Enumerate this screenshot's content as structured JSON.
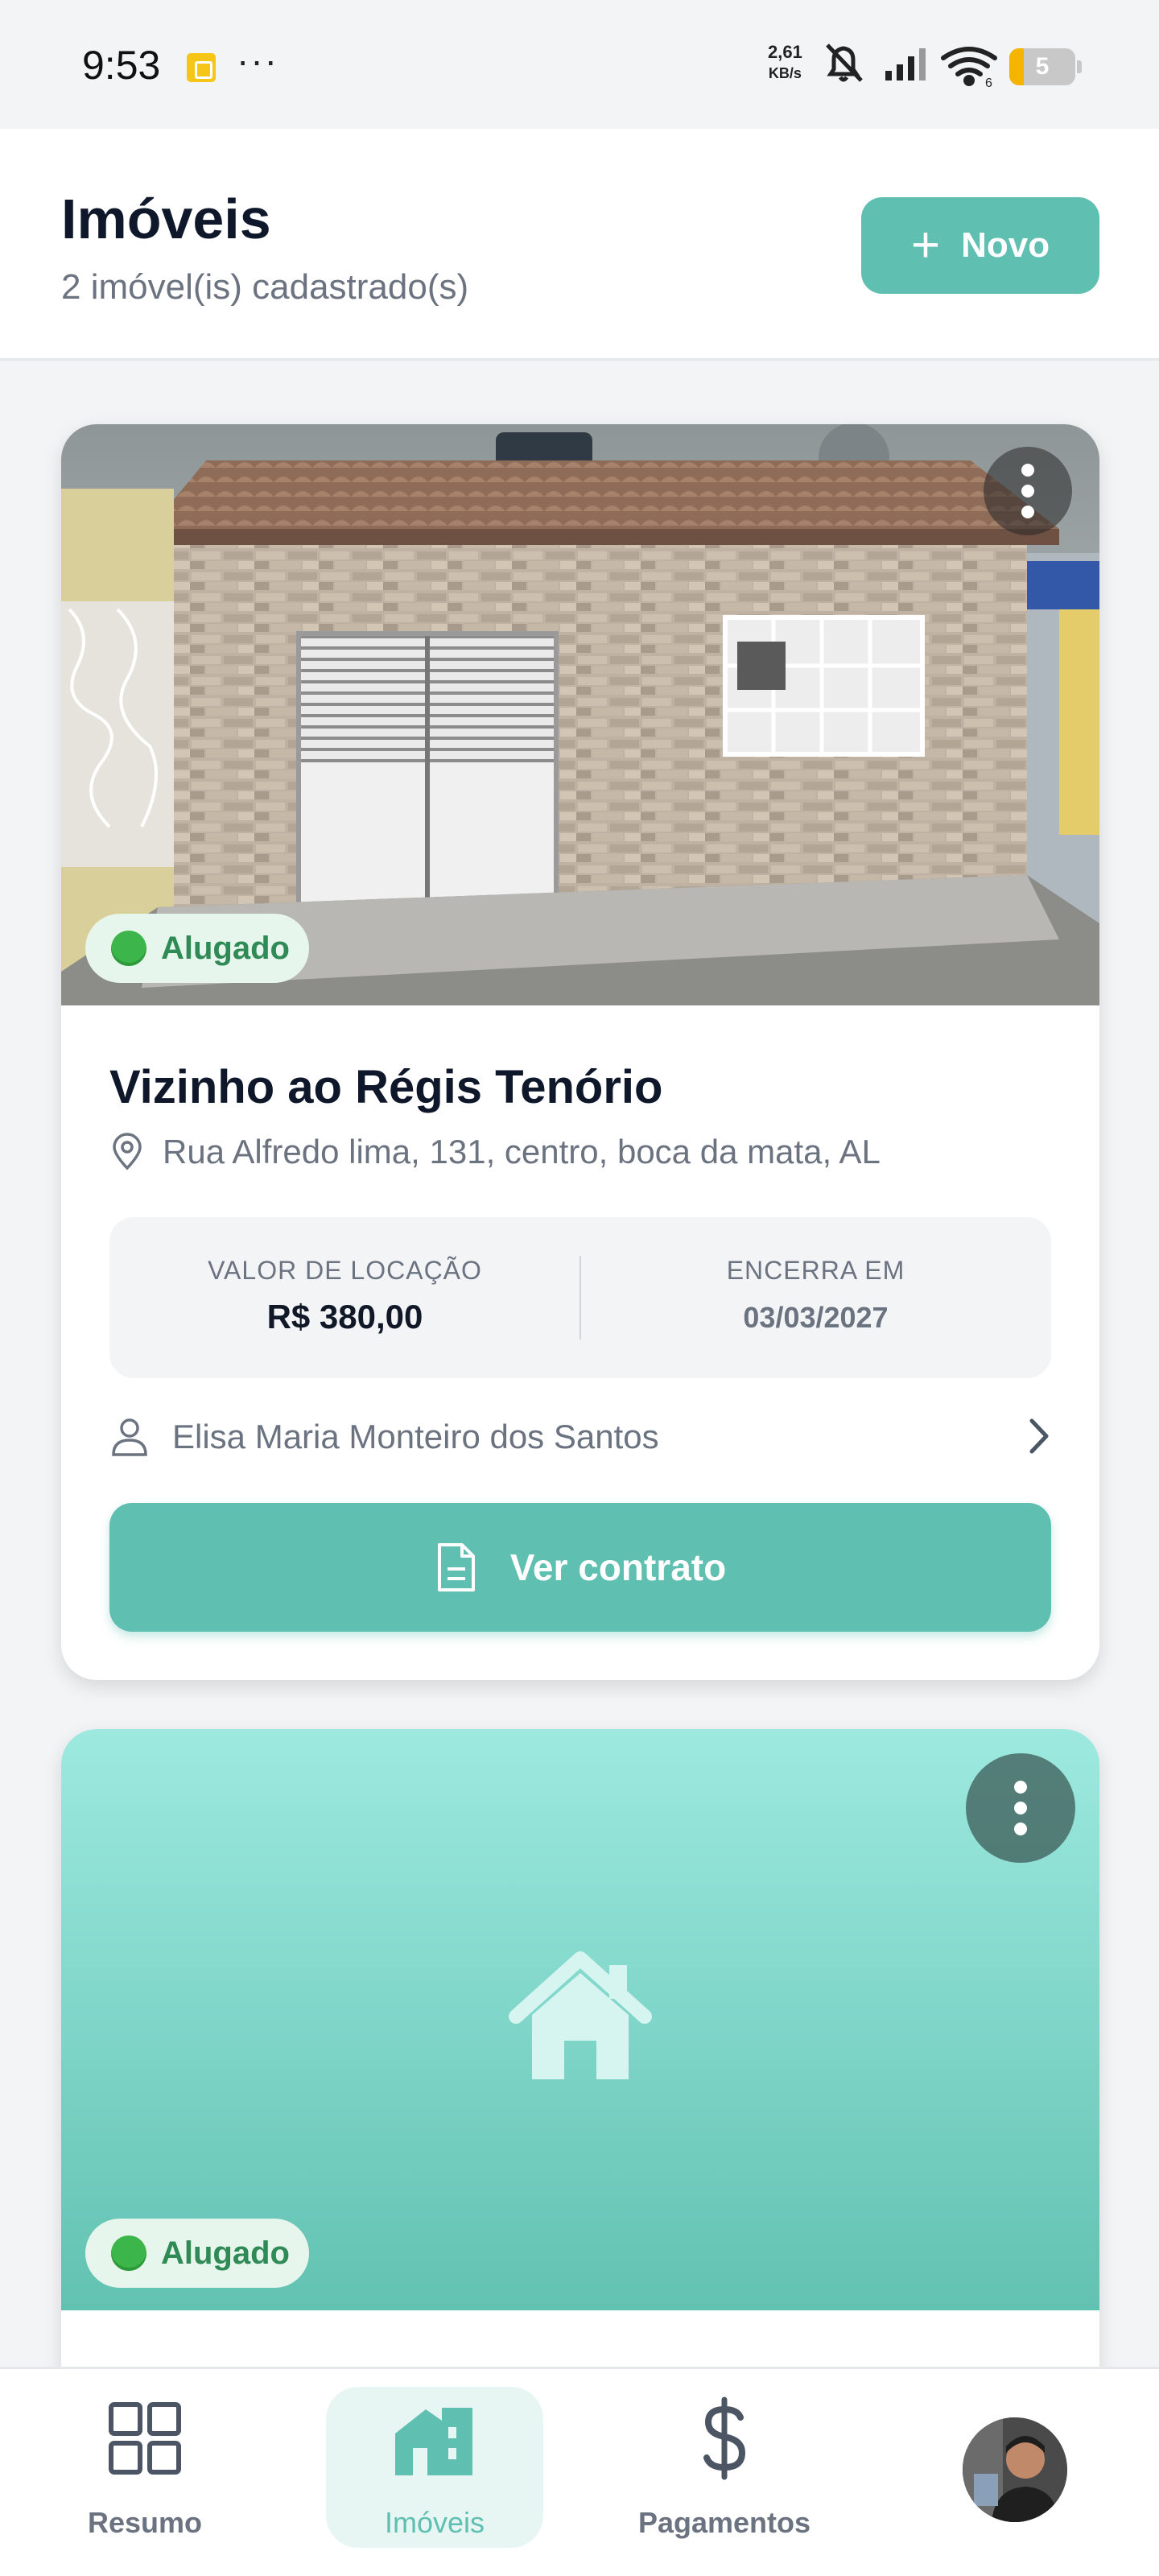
{
  "status_bar": {
    "time": "9:53",
    "more": "···",
    "speed_value": "2,61",
    "speed_unit": "KB/s",
    "wifi_label": "6",
    "battery": "5",
    "icons": [
      "notification-icon",
      "mute-icon",
      "signal-icon",
      "wifi-icon",
      "battery-icon"
    ]
  },
  "header": {
    "title": "Imóveis",
    "subtitle": "2 imóvel(is) cadastrado(s)",
    "new_button_label": "Novo"
  },
  "properties": [
    {
      "status": "Alugado",
      "title": "Vizinho ao Régis Tenório",
      "address": "Rua Alfredo lima, 131, centro, boca da mata,  AL",
      "rent_label": "VALOR DE LOCAÇÃO",
      "rent_value": "R$ 380,00",
      "end_label": "ENCERRA EM",
      "end_value": "03/03/2027",
      "tenant": "Elisa Maria Monteiro dos Santos",
      "contract_button": "Ver contrato"
    },
    {
      "status": "Alugado"
    }
  ],
  "bottom_nav": [
    {
      "label": "Resumo",
      "icon": "grid-icon",
      "active": false
    },
    {
      "label": "Imóveis",
      "icon": "building-icon",
      "active": true
    },
    {
      "label": "Pagamentos",
      "icon": "dollar-icon",
      "active": false
    },
    {
      "label": "",
      "icon": "avatar",
      "active": false
    }
  ],
  "colors": {
    "accent": "#5fbfb0",
    "status_green": "#2f8a55",
    "status_bg": "#e7f6ec"
  }
}
